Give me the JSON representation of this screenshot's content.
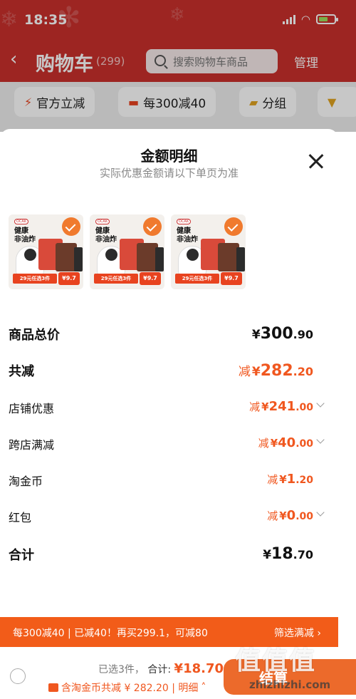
{
  "status": {
    "time": "18:35"
  },
  "header": {
    "back_icon": "back-arrow-icon",
    "title": "购物车",
    "count": "(299)",
    "search_placeholder": "搜索购物车商品",
    "manage": "管理"
  },
  "filters": [
    {
      "label": "官方立减",
      "icon": "lightning-icon"
    },
    {
      "label": "每300减40",
      "icon": "coupon-icon"
    },
    {
      "label": "分组",
      "icon": "folder-icon"
    }
  ],
  "sheet": {
    "title": "金额明细",
    "subtitle": "实际优惠金额请以下单页为准",
    "items": [
      {
        "name": "健康\n非油炸",
        "logo": "OCAK",
        "promo": "29元任选3件",
        "price": "¥9.7"
      },
      {
        "name": "健康\n非油炸",
        "logo": "OCAK",
        "promo": "29元任选3件",
        "price": "¥9.7"
      },
      {
        "name": "健康\n非油炸",
        "logo": "OCAK",
        "promo": "29元任选3件",
        "price": "¥9.7"
      }
    ],
    "rows": {
      "goods_total": {
        "label": "商品总价",
        "prefix": "",
        "yuan": "¥",
        "int": "300",
        "dec": ".90"
      },
      "total_discount": {
        "label": "共减",
        "prefix": "减",
        "yuan": "¥",
        "int": "282",
        "dec": ".20"
      },
      "shop_discount": {
        "label": "店铺优惠",
        "prefix": "减",
        "yuan": "¥",
        "int": "241",
        "dec": ".00"
      },
      "cross_store": {
        "label": "跨店满减",
        "prefix": "减",
        "yuan": "¥",
        "int": "40",
        "dec": ".00"
      },
      "taojinbi": {
        "label": "淘金币",
        "prefix": "减",
        "yuan": "¥",
        "int": "1",
        "dec": ".20"
      },
      "red_packet": {
        "label": "红包",
        "prefix": "减",
        "yuan": "¥",
        "int": "0",
        "dec": ".00"
      },
      "total": {
        "label": "合计",
        "prefix": "",
        "yuan": "¥",
        "int": "18",
        "dec": ".70"
      }
    }
  },
  "promo_banner": {
    "text": "每300减40 | 已减40！再买299.1，可减80",
    "link": "筛选满减"
  },
  "bottom": {
    "selected": "已选3件，",
    "total_label": "合计:",
    "total_value": "¥18.70",
    "sub": "含淘金币共减 ¥ 282.20 | 明细",
    "checkout": "结算"
  },
  "watermark": {
    "text": "值值值",
    "url": "zhizhizhi.com"
  },
  "colors": {
    "accent": "#f0571f",
    "header_red": "#c9302c",
    "banner": "#f25c19"
  }
}
